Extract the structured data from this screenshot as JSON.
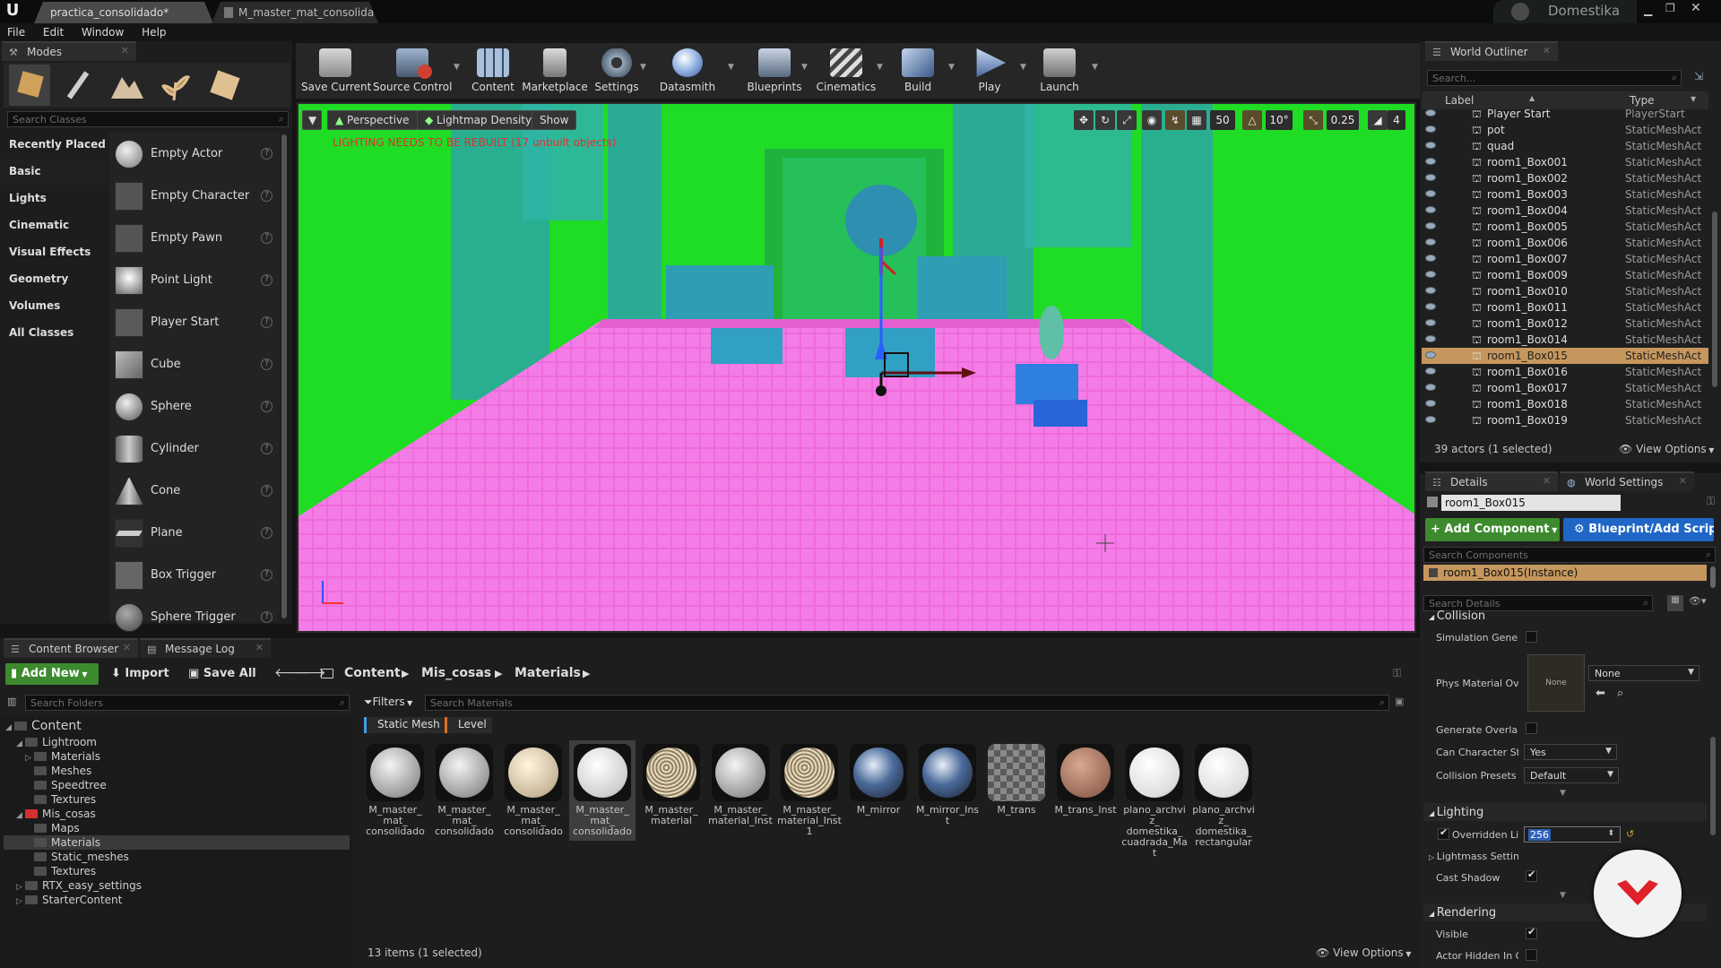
{
  "window": {
    "tabs": [
      "practica_consolidado*",
      "M_master_mat_consolidad"
    ],
    "brand": "Domestika"
  },
  "menu": [
    "File",
    "Edit",
    "Window",
    "Help"
  ],
  "modes": {
    "tab_label": "Modes",
    "search_placeholder": "Search Classes",
    "categories": [
      "Recently Placed",
      "Basic",
      "Lights",
      "Cinematic",
      "Visual Effects",
      "Geometry",
      "Volumes",
      "All Classes"
    ],
    "items": [
      "Empty Actor",
      "Empty Character",
      "Empty Pawn",
      "Point Light",
      "Player Start",
      "Cube",
      "Sphere",
      "Cylinder",
      "Cone",
      "Plane",
      "Box Trigger",
      "Sphere Trigger"
    ]
  },
  "toolbar": {
    "buttons": [
      "Save Current",
      "Source Control",
      "Content",
      "Marketplace",
      "Settings",
      "Datasmith",
      "Blueprints",
      "Cinematics",
      "Build",
      "Play",
      "Launch"
    ]
  },
  "viewport": {
    "perspective": "Perspective",
    "view_mode": "Lightmap Density",
    "show": "Show",
    "warning": "LIGHTING NEEDS TO BE REBUILT (17 unbuilt objects)",
    "grid_value": "50",
    "angle_value": "10°",
    "scale_value": "0.25",
    "camera_speed": "4"
  },
  "outliner": {
    "tab_label": "World Outliner",
    "search_placeholder": "Search...",
    "col_label": "Label",
    "col_type": "Type",
    "rows": [
      {
        "label": "Player Start",
        "type": "PlayerStart"
      },
      {
        "label": "pot",
        "type": "StaticMeshActor"
      },
      {
        "label": "quad",
        "type": "StaticMeshActor"
      },
      {
        "label": "room1_Box001",
        "type": "StaticMeshActor"
      },
      {
        "label": "room1_Box002",
        "type": "StaticMeshActor"
      },
      {
        "label": "room1_Box003",
        "type": "StaticMeshActor"
      },
      {
        "label": "room1_Box004",
        "type": "StaticMeshActor"
      },
      {
        "label": "room1_Box005",
        "type": "StaticMeshActor"
      },
      {
        "label": "room1_Box006",
        "type": "StaticMeshActor"
      },
      {
        "label": "room1_Box007",
        "type": "StaticMeshActor"
      },
      {
        "label": "room1_Box009",
        "type": "StaticMeshActor"
      },
      {
        "label": "room1_Box010",
        "type": "StaticMeshActor"
      },
      {
        "label": "room1_Box011",
        "type": "StaticMeshActor"
      },
      {
        "label": "room1_Box012",
        "type": "StaticMeshActor"
      },
      {
        "label": "room1_Box014",
        "type": "StaticMeshActor"
      },
      {
        "label": "room1_Box015",
        "type": "StaticMeshActor"
      },
      {
        "label": "room1_Box016",
        "type": "StaticMeshActor"
      },
      {
        "label": "room1_Box017",
        "type": "StaticMeshActor"
      },
      {
        "label": "room1_Box018",
        "type": "StaticMeshActor"
      },
      {
        "label": "room1_Box019",
        "type": "StaticMeshActor"
      }
    ],
    "status": "39 actors (1 selected)",
    "view_options": "View Options"
  },
  "details": {
    "tab_label": "Details",
    "tab2_label": "World Settings",
    "actor_name": "room1_Box015",
    "add_component": "+ Add Component",
    "blueprint": "Blueprint/Add Script",
    "search_components": "Search Components",
    "instance": "room1_Box015(Instance)",
    "search_details": "Search Details",
    "collision_header": "Collision",
    "simulation": "Simulation Generates Hit Events",
    "phys_material": "Phys Material Override",
    "none_thumb": "None",
    "none_combo": "None",
    "generate_overlap": "Generate Overlap Events",
    "can_step": "Can Character Step Up On",
    "can_step_value": "Yes",
    "collision_presets": "Collision Presets",
    "collision_presets_value": "Default",
    "lighting_header": "Lighting",
    "overridden": "Overridden Light Map Res",
    "overridden_value": "256",
    "lightmass": "Lightmass Settings",
    "cast_shadow": "Cast Shadow",
    "rendering_header": "Rendering",
    "visible": "Visible",
    "hidden": "Actor Hidden In Game"
  },
  "content": {
    "tab_label": "Content Browser",
    "tab2_label": "Message Log",
    "add_new": "Add New",
    "import": "Import",
    "save_all": "Save All",
    "breadcrumb": [
      "Content",
      "Mis_cosas",
      "Materials"
    ],
    "search_folders": "Search Folders",
    "filters": "Filters",
    "search_materials": "Search Materials",
    "filter_tags": [
      "Static Mesh",
      "Level"
    ],
    "tree": [
      "Content",
      "Lightroom",
      "Materials",
      "Meshes",
      "Speedtree",
      "Textures",
      "Mis_cosas",
      "Maps",
      "Materials",
      "Static_meshes",
      "Textures",
      "RTX_easy_settings",
      "StarterContent"
    ],
    "assets": [
      {
        "name": "M_master_\nmat_\nconsolidado"
      },
      {
        "name": "M_master_\nmat_\nconsolidado"
      },
      {
        "name": "M_master_\nmat_\nconsolidado"
      },
      {
        "name": "M_master_\nmat_\nconsolidado"
      },
      {
        "name": "M_master_\nmaterial"
      },
      {
        "name": "M_master_\nmaterial_Inst"
      },
      {
        "name": "M_master_\nmaterial_Inst1"
      },
      {
        "name": "M_mirror"
      },
      {
        "name": "M_mirror_Inst"
      },
      {
        "name": "M_trans"
      },
      {
        "name": "M_trans_Inst"
      },
      {
        "name": "plano_archviz_\ndomestika_\ncuadrada_Mat"
      },
      {
        "name": "plano_archviz_\ndomestika_\nrectangular"
      }
    ],
    "status": "13 items (1 selected)",
    "view_options": "View Options"
  }
}
